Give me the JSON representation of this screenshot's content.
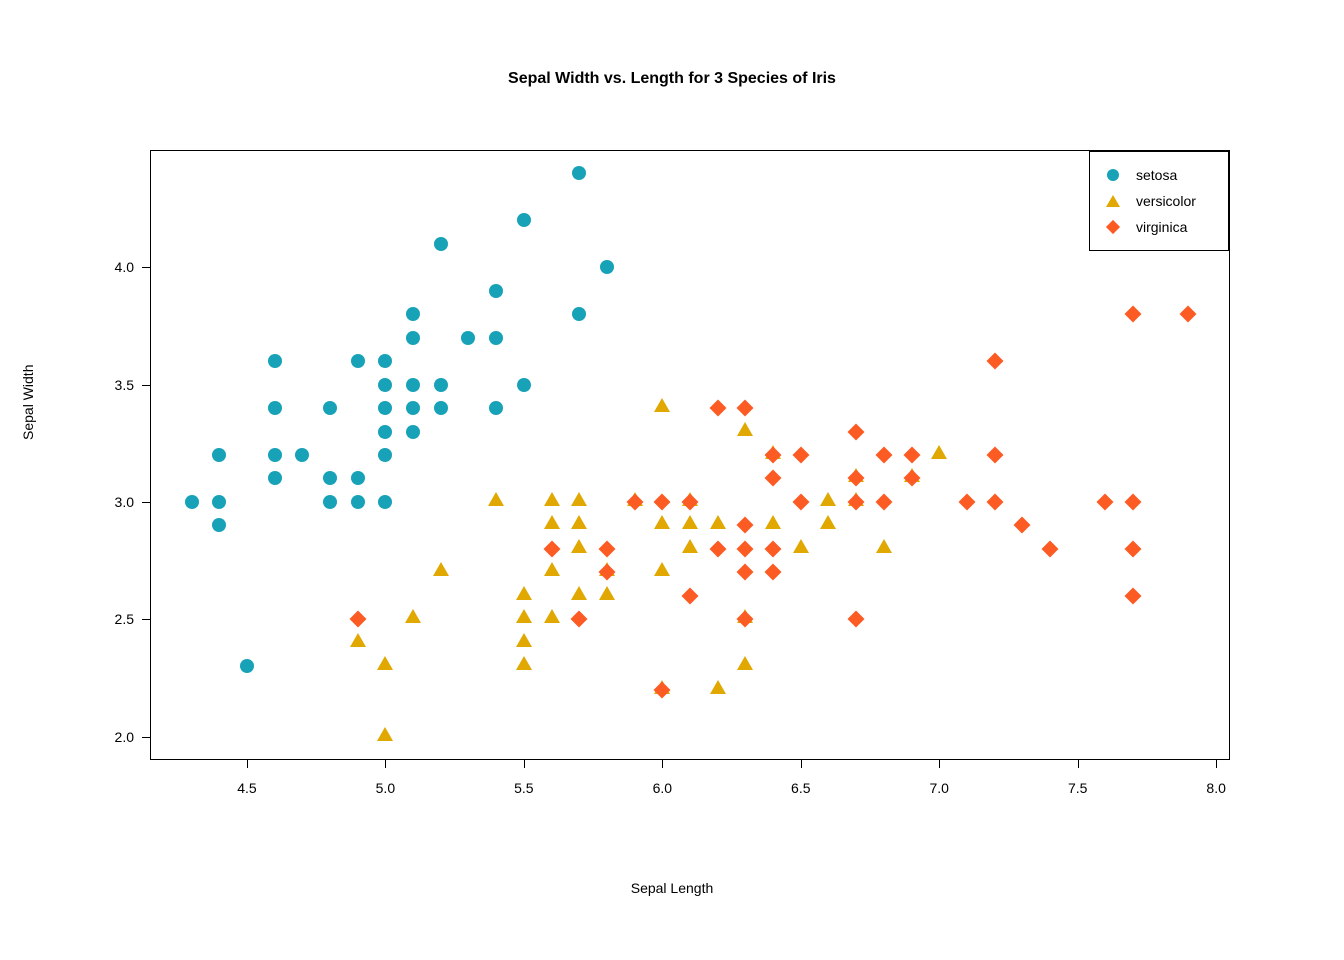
{
  "chart_data": {
    "type": "scatter",
    "title": "Sepal Width vs. Length for 3 Species of Iris",
    "xlabel": "Sepal Length",
    "ylabel": "Sepal Width",
    "xlim": [
      4.15,
      8.05
    ],
    "ylim": [
      1.9,
      4.5
    ],
    "x_ticks": [
      4.5,
      5.0,
      5.5,
      6.0,
      6.5,
      7.0,
      7.5,
      8.0
    ],
    "y_ticks": [
      2.0,
      2.5,
      3.0,
      3.5,
      4.0
    ],
    "x_tick_labels": [
      "4.5",
      "5.0",
      "5.5",
      "6.0",
      "6.5",
      "7.0",
      "7.5",
      "8.0"
    ],
    "y_tick_labels": [
      "2.0",
      "2.5",
      "3.0",
      "3.5",
      "4.0"
    ],
    "legend_position": "topright",
    "series": [
      {
        "name": "setosa",
        "marker": "circle",
        "color": "#17a2b8",
        "points": [
          [
            4.3,
            3.0
          ],
          [
            4.4,
            2.9
          ],
          [
            4.4,
            3.0
          ],
          [
            4.4,
            3.2
          ],
          [
            4.5,
            2.3
          ],
          [
            4.6,
            3.1
          ],
          [
            4.6,
            3.2
          ],
          [
            4.6,
            3.4
          ],
          [
            4.6,
            3.6
          ],
          [
            4.7,
            3.2
          ],
          [
            4.8,
            3.0
          ],
          [
            4.8,
            3.1
          ],
          [
            4.8,
            3.4
          ],
          [
            4.9,
            3.0
          ],
          [
            4.9,
            3.1
          ],
          [
            4.9,
            3.6
          ],
          [
            5.0,
            3.0
          ],
          [
            5.0,
            3.2
          ],
          [
            5.0,
            3.3
          ],
          [
            5.0,
            3.4
          ],
          [
            5.0,
            3.5
          ],
          [
            5.0,
            3.6
          ],
          [
            5.1,
            3.3
          ],
          [
            5.1,
            3.4
          ],
          [
            5.1,
            3.5
          ],
          [
            5.1,
            3.7
          ],
          [
            5.1,
            3.8
          ],
          [
            5.2,
            3.4
          ],
          [
            5.2,
            3.5
          ],
          [
            5.2,
            4.1
          ],
          [
            5.3,
            3.7
          ],
          [
            5.4,
            3.4
          ],
          [
            5.4,
            3.7
          ],
          [
            5.4,
            3.9
          ],
          [
            5.5,
            3.5
          ],
          [
            5.5,
            4.2
          ],
          [
            5.7,
            3.8
          ],
          [
            5.7,
            4.4
          ],
          [
            5.8,
            4.0
          ]
        ]
      },
      {
        "name": "versicolor",
        "marker": "triangle",
        "color": "#e0a800",
        "points": [
          [
            4.9,
            2.4
          ],
          [
            5.0,
            2.0
          ],
          [
            5.0,
            2.3
          ],
          [
            5.1,
            2.5
          ],
          [
            5.2,
            2.7
          ],
          [
            5.4,
            3.0
          ],
          [
            5.5,
            2.3
          ],
          [
            5.5,
            2.4
          ],
          [
            5.5,
            2.5
          ],
          [
            5.5,
            2.6
          ],
          [
            5.6,
            2.5
          ],
          [
            5.6,
            2.7
          ],
          [
            5.6,
            2.9
          ],
          [
            5.6,
            3.0
          ],
          [
            5.7,
            2.6
          ],
          [
            5.7,
            2.8
          ],
          [
            5.7,
            2.9
          ],
          [
            5.7,
            3.0
          ],
          [
            5.8,
            2.6
          ],
          [
            5.8,
            2.7
          ],
          [
            5.9,
            3.0
          ],
          [
            6.0,
            2.2
          ],
          [
            6.0,
            2.7
          ],
          [
            6.0,
            2.9
          ],
          [
            6.0,
            3.4
          ],
          [
            6.1,
            2.8
          ],
          [
            6.1,
            2.9
          ],
          [
            6.1,
            3.0
          ],
          [
            6.2,
            2.2
          ],
          [
            6.2,
            2.9
          ],
          [
            6.3,
            2.3
          ],
          [
            6.3,
            2.5
          ],
          [
            6.3,
            3.3
          ],
          [
            6.4,
            2.9
          ],
          [
            6.4,
            3.2
          ],
          [
            6.5,
            2.8
          ],
          [
            6.6,
            2.9
          ],
          [
            6.6,
            3.0
          ],
          [
            6.7,
            3.0
          ],
          [
            6.7,
            3.1
          ],
          [
            6.8,
            2.8
          ],
          [
            6.9,
            3.1
          ],
          [
            7.0,
            3.2
          ]
        ]
      },
      {
        "name": "virginica",
        "marker": "diamond",
        "color": "#fd5b24",
        "points": [
          [
            4.9,
            2.5
          ],
          [
            5.6,
            2.8
          ],
          [
            5.7,
            2.5
          ],
          [
            5.8,
            2.7
          ],
          [
            5.8,
            2.8
          ],
          [
            5.9,
            3.0
          ],
          [
            6.0,
            2.2
          ],
          [
            6.0,
            3.0
          ],
          [
            6.1,
            2.6
          ],
          [
            6.1,
            3.0
          ],
          [
            6.2,
            2.8
          ],
          [
            6.2,
            3.4
          ],
          [
            6.3,
            2.5
          ],
          [
            6.3,
            2.7
          ],
          [
            6.3,
            2.8
          ],
          [
            6.3,
            2.9
          ],
          [
            6.3,
            3.4
          ],
          [
            6.4,
            2.7
          ],
          [
            6.4,
            2.8
          ],
          [
            6.4,
            3.1
          ],
          [
            6.4,
            3.2
          ],
          [
            6.5,
            3.0
          ],
          [
            6.5,
            3.2
          ],
          [
            6.7,
            2.5
          ],
          [
            6.7,
            3.0
          ],
          [
            6.7,
            3.1
          ],
          [
            6.7,
            3.3
          ],
          [
            6.8,
            3.0
          ],
          [
            6.8,
            3.2
          ],
          [
            6.9,
            3.1
          ],
          [
            6.9,
            3.2
          ],
          [
            7.1,
            3.0
          ],
          [
            7.2,
            3.0
          ],
          [
            7.2,
            3.2
          ],
          [
            7.2,
            3.6
          ],
          [
            7.3,
            2.9
          ],
          [
            7.4,
            2.8
          ],
          [
            7.6,
            3.0
          ],
          [
            7.7,
            2.6
          ],
          [
            7.7,
            2.8
          ],
          [
            7.7,
            3.0
          ],
          [
            7.7,
            3.8
          ],
          [
            7.9,
            3.8
          ]
        ]
      }
    ]
  }
}
